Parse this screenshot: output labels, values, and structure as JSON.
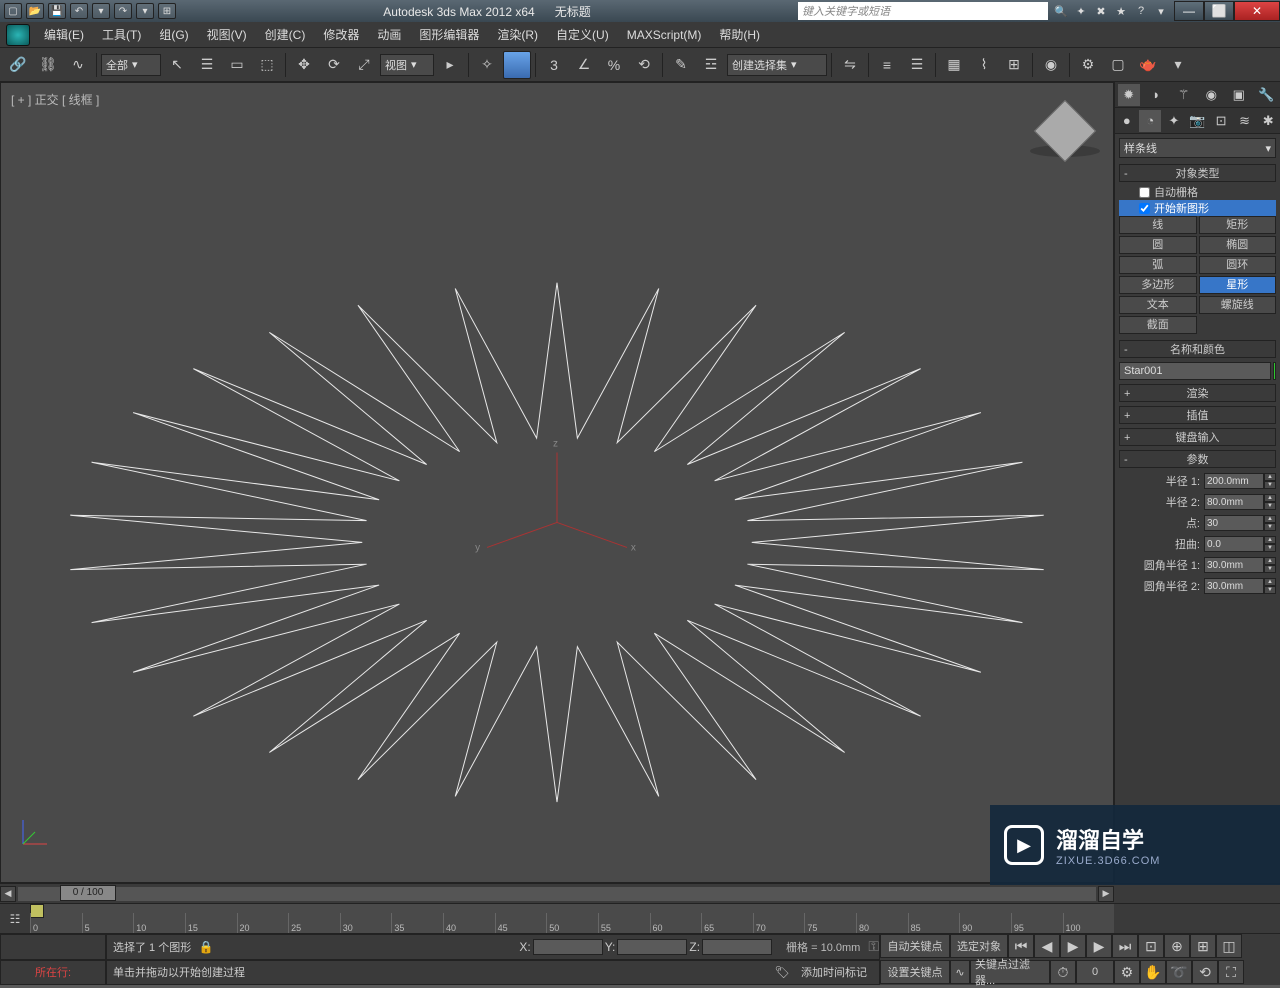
{
  "title": {
    "app": "Autodesk 3ds Max  2012 x64",
    "doc": "无标题",
    "search_placeholder": "键入关键字或短语"
  },
  "menu": [
    "编辑(E)",
    "工具(T)",
    "组(G)",
    "视图(V)",
    "创建(C)",
    "修改器",
    "动画",
    "图形编辑器",
    "渲染(R)",
    "自定义(U)",
    "MAXScript(M)",
    "帮助(H)"
  ],
  "toolbar": {
    "filter_all": "全部",
    "ref_dropdown": "视图",
    "named_set": "创建选择集"
  },
  "viewport": {
    "label": "[ + ] 正交 [ 线框 ]",
    "axes": {
      "x": "x",
      "y": "y",
      "z": "z"
    }
  },
  "panel": {
    "category": "样条线",
    "rollouts": {
      "object_type": "对象类型",
      "auto_grid": "自动栅格",
      "start_shape": "开始新图形",
      "name_color": "名称和颜色",
      "render": "渲染",
      "interp": "插值",
      "keyboard": "键盘输入",
      "params": "参数"
    },
    "shapes": {
      "line": "线",
      "rectangle": "矩形",
      "circle": "圆",
      "ellipse": "椭圆",
      "arc": "弧",
      "donut": "圆环",
      "ngon": "多边形",
      "star": "星形",
      "text": "文本",
      "helix": "螺旋线",
      "section": "截面"
    },
    "name_value": "Star001",
    "params": {
      "radius1_label": "半径 1:",
      "radius1": "200.0mm",
      "radius2_label": "半径 2:",
      "radius2": "80.0mm",
      "points_label": "点:",
      "points": "30",
      "distortion_label": "扭曲:",
      "distortion": "0.0",
      "fillet1_label": "圆角半径 1:",
      "fillet1": "30.0mm",
      "fillet2_label": "圆角半径 2:",
      "fillet2": "30.0mm"
    }
  },
  "timeline": {
    "frame_label": "0 / 100",
    "ticks": [
      "0",
      "5",
      "10",
      "15",
      "20",
      "25",
      "30",
      "35",
      "40",
      "45",
      "50",
      "55",
      "60",
      "65",
      "70",
      "75",
      "80",
      "85",
      "90",
      "95",
      "100"
    ]
  },
  "status": {
    "row1_text": "选择了 1 个图形",
    "row2_text": "单击并拖动以开始创建过程",
    "grid": "栅格 = 10.0mm",
    "auto_key": "自动关键点",
    "sel_obj": "选定对象",
    "set_key": "设置关键点",
    "key_filter": "关键点过滤器...",
    "frame_spin": "0",
    "add_tag": "添加时间标记",
    "presence": "所在行:",
    "coords": {
      "x": "X:",
      "y": "Y:",
      "z": "Z:"
    }
  },
  "watermark": {
    "brand": "溜溜自学",
    "url": "ZIXUE.3D66.COM"
  }
}
